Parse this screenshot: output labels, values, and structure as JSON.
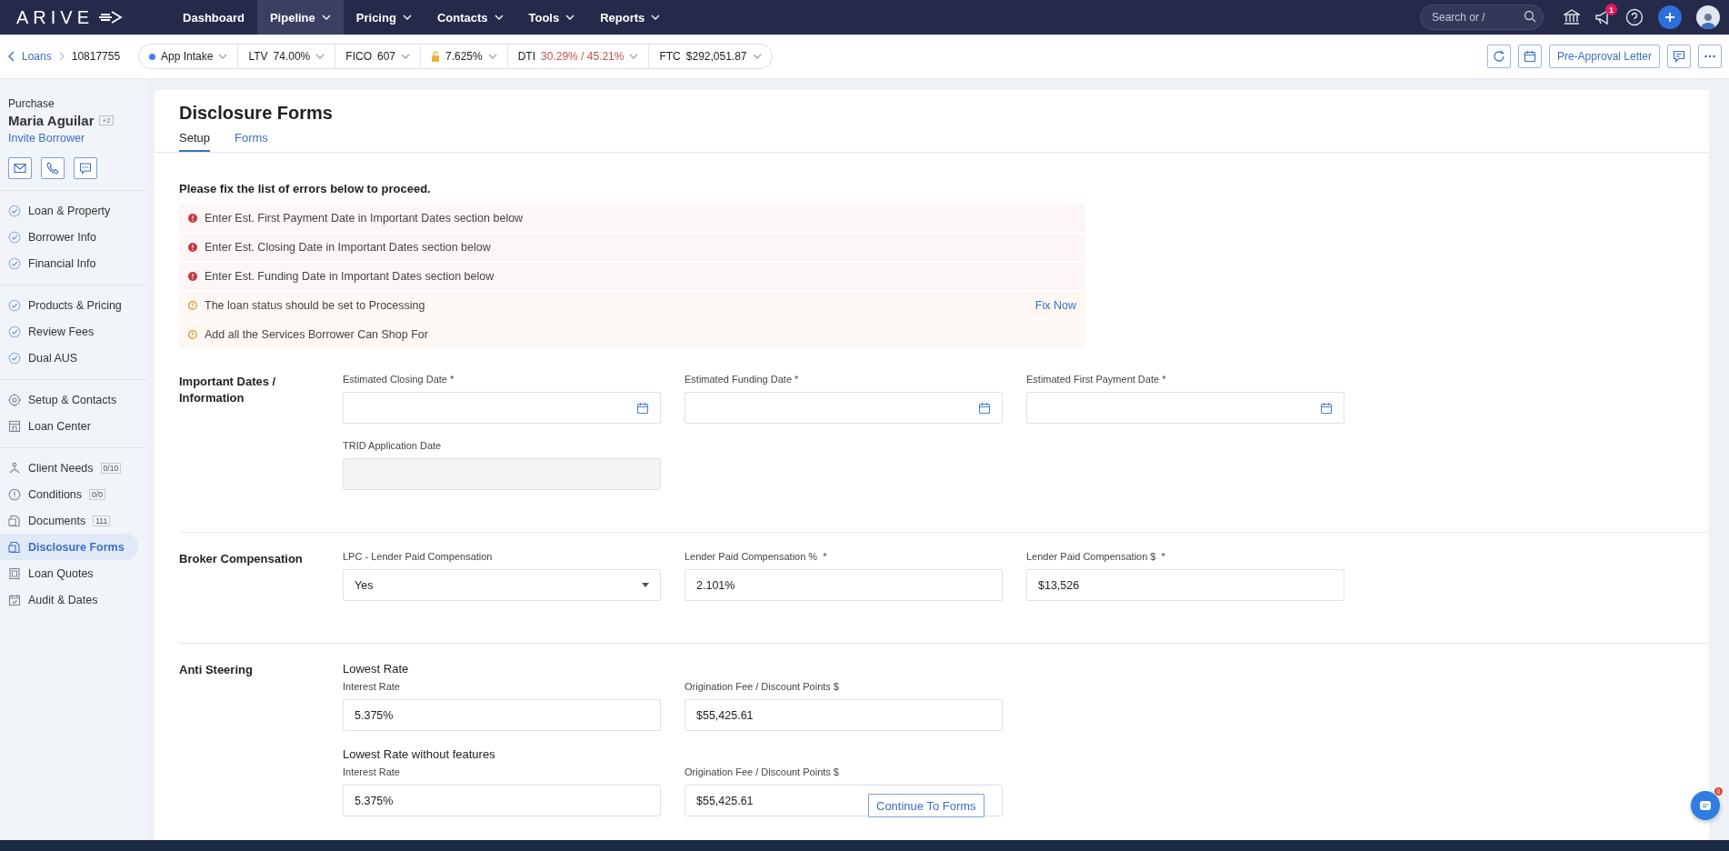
{
  "nav": {
    "logo": "ARIVE",
    "items": [
      {
        "label": "Dashboard",
        "selected": false,
        "dropdown": false
      },
      {
        "label": "Pipeline",
        "selected": true,
        "dropdown": true
      },
      {
        "label": "Pricing",
        "selected": false,
        "dropdown": true
      },
      {
        "label": "Contacts",
        "selected": false,
        "dropdown": true
      },
      {
        "label": "Tools",
        "selected": false,
        "dropdown": true
      },
      {
        "label": "Reports",
        "selected": false,
        "dropdown": true
      }
    ],
    "search": {
      "placeholder": "Search or /"
    },
    "notification_badge": "1"
  },
  "loan_bar": {
    "back": "Loans",
    "loan_number": "10817755",
    "pills": [
      {
        "kind": "status",
        "label": "App Intake",
        "color": "#3b82f6"
      },
      {
        "kind": "metric",
        "label": "LTV",
        "value": "74.00%",
        "alert": false
      },
      {
        "kind": "metric",
        "label": "FICO",
        "value": "607",
        "alert": false
      },
      {
        "kind": "rate",
        "value": "7.625%"
      },
      {
        "kind": "metric",
        "label": "DTI",
        "value": "30.29% / 45.21%",
        "alert": true
      },
      {
        "kind": "metric",
        "label": "FTC",
        "value": "$292,051.87",
        "alert": false
      }
    ],
    "letter_button": "Pre-Approval Letter"
  },
  "sidebar": {
    "loan_type": "Purchase",
    "borrower": "Maria Aguilar",
    "borrower_count": "+2",
    "invite": "Invite Borrower",
    "groups": [
      {
        "items": [
          {
            "label": "Loan & Property",
            "kind": "step",
            "selected": false
          },
          {
            "label": "Borrower Info",
            "kind": "step",
            "selected": false
          },
          {
            "label": "Financial Info",
            "kind": "step",
            "selected": false
          }
        ]
      },
      {
        "items": [
          {
            "label": "Products & Pricing",
            "kind": "step",
            "selected": false
          },
          {
            "label": "Review Fees",
            "kind": "step",
            "selected": false
          },
          {
            "label": "Dual AUS",
            "kind": "step",
            "selected": false
          }
        ]
      },
      {
        "items": [
          {
            "label": "Setup & Contacts",
            "kind": "page",
            "selected": false
          },
          {
            "label": "Loan Center",
            "kind": "page",
            "selected": false
          }
        ]
      },
      {
        "items": [
          {
            "label": "Client Needs",
            "kind": "page",
            "selected": false,
            "count": "0/10"
          },
          {
            "label": "Conditions",
            "kind": "page",
            "selected": false,
            "count": "0/0"
          },
          {
            "label": "Documents",
            "kind": "page",
            "selected": false,
            "count": "111"
          },
          {
            "label": "Disclosure Forms",
            "kind": "page",
            "selected": true
          },
          {
            "label": "Loan Quotes",
            "kind": "page",
            "selected": false
          },
          {
            "label": "Audit & Dates",
            "kind": "page",
            "selected": false
          }
        ]
      }
    ]
  },
  "page": {
    "title": "Disclosure Forms",
    "tabs": [
      {
        "label": "Setup",
        "selected": true
      },
      {
        "label": "Forms",
        "selected": false
      }
    ],
    "errors_heading": "Please fix the list of errors below to proceed.",
    "errors": [
      {
        "kind": "error",
        "text": "Enter Est. First Payment Date in Important Dates section below"
      },
      {
        "kind": "error",
        "text": "Enter Est. Closing Date in Important Dates section below"
      },
      {
        "kind": "error",
        "text": "Enter Est. Funding Date in Important Dates section below"
      },
      {
        "kind": "warning",
        "text": "The loan status should be set to Processing",
        "action": "Fix Now"
      },
      {
        "kind": "warning",
        "text": "Add all the Services Borrower Can Shop For"
      }
    ],
    "sections": [
      {
        "title": "Important Dates / Information",
        "groups": [
          {
            "fields": [
              {
                "label": "Estimated Closing Date *",
                "kind": "date"
              },
              {
                "label": "Estimated Funding Date *",
                "kind": "date"
              },
              {
                "label": "Estimated First Payment Date *",
                "kind": "date"
              }
            ]
          },
          {
            "fields": [
              {
                "label": "TRID Application Date",
                "kind": "readonly"
              }
            ]
          }
        ]
      },
      {
        "title": "Broker Compensation",
        "groups": [
          {
            "fields": [
              {
                "label": "LPC - Lender Paid Compensation",
                "kind": "select",
                "value": "Yes"
              },
              {
                "label": "Lender Paid Compensation %  *",
                "kind": "text",
                "value": "2.101%"
              },
              {
                "label": "Lender Paid Compensation $  *",
                "kind": "text",
                "value": "$13,526"
              }
            ]
          }
        ]
      },
      {
        "title": "Anti Steering",
        "groups": [
          {
            "heading": "Lowest Rate",
            "fields": [
              {
                "label": "Interest Rate",
                "kind": "text",
                "value": "5.375%"
              },
              {
                "label": "Origination Fee / Discount Points $",
                "kind": "text",
                "value": "$55,425.61"
              }
            ]
          },
          {
            "heading": "Lowest Rate without features",
            "fields": [
              {
                "label": "Interest Rate",
                "kind": "text",
                "value": "5.375%"
              },
              {
                "label": "Origination Fee / Discount Points $",
                "kind": "text",
                "value": "$55,425.61"
              }
            ]
          }
        ]
      }
    ],
    "continue_button": "Continue To Forms"
  },
  "chat": {
    "badge": "0"
  }
}
